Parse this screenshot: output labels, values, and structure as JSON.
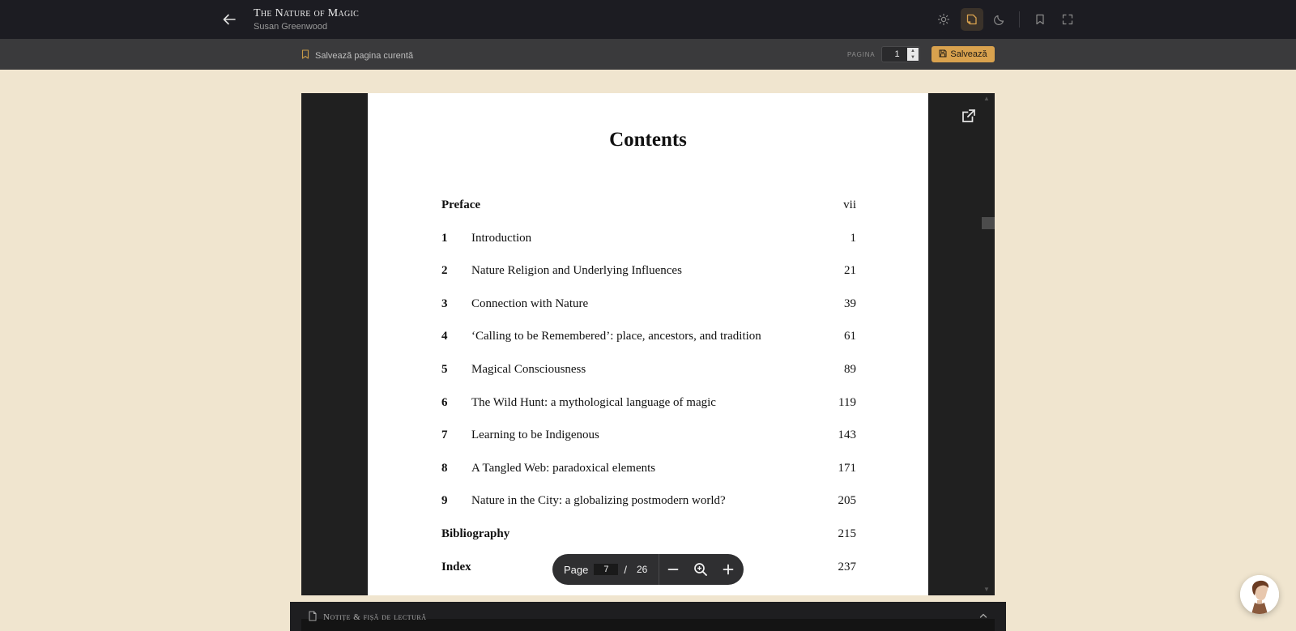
{
  "header": {
    "book_title": "The Nature of Magic",
    "book_author": "Susan Greenwood",
    "icons": [
      "back-arrow-icon",
      "sun-icon",
      "book-mode-icon",
      "moon-icon",
      "bookmark-icon",
      "fullscreen-icon"
    ],
    "active_icon": "book-mode-icon"
  },
  "savebar": {
    "save_current_label": "Salvează pagina curentă",
    "page_label": "PAGINA",
    "page_value": "1",
    "save_button_label": "Salvează"
  },
  "document": {
    "heading": "Contents",
    "toc": [
      {
        "num": "",
        "title": "Preface",
        "page": "vii"
      },
      {
        "num": "1",
        "title": "Introduction",
        "page": "1"
      },
      {
        "num": "2",
        "title": "Nature Religion and Underlying Influences",
        "page": "21"
      },
      {
        "num": "3",
        "title": "Connection with Nature",
        "page": "39"
      },
      {
        "num": "4",
        "title": "‘Calling to be Remembered’: place, ancestors, and tradition",
        "page": "61"
      },
      {
        "num": "5",
        "title": "Magical Consciousness",
        "page": "89"
      },
      {
        "num": "6",
        "title": "The Wild Hunt: a mythological language of magic",
        "page": "119"
      },
      {
        "num": "7",
        "title": "Learning to be Indigenous",
        "page": "143"
      },
      {
        "num": "8",
        "title": "A Tangled Web: paradoxical elements",
        "page": "171"
      },
      {
        "num": "9",
        "title": "Nature in the City: a globalizing postmodern world?",
        "page": "205"
      },
      {
        "num": "",
        "title": "Bibliography",
        "page": "215"
      },
      {
        "num": "",
        "title": "Index",
        "page": "237"
      }
    ]
  },
  "pager": {
    "label": "Page",
    "current": "7",
    "separator": "/",
    "total": "26"
  },
  "notes": {
    "label": "Notițe & fișă de lectură"
  },
  "colors": {
    "background": "#f0e5cf",
    "header": "#1c1c22",
    "accent": "#d9a24e"
  }
}
